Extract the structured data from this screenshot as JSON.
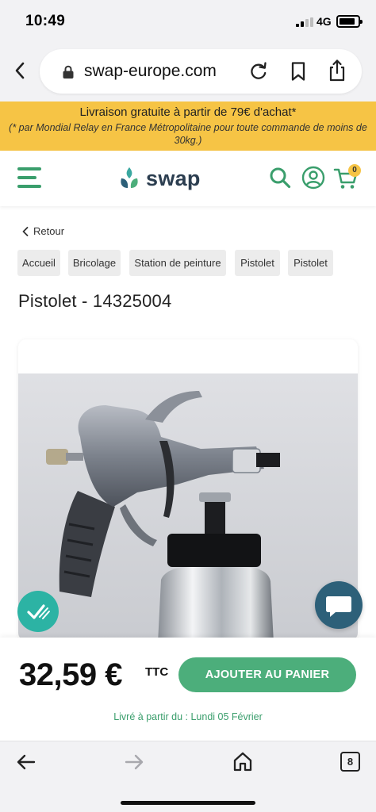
{
  "status_bar": {
    "time": "10:49",
    "network": "4G"
  },
  "browser": {
    "url": "swap-europe.com",
    "tab_count": "8"
  },
  "promo": {
    "main": "Livraison gratuite à partir de 79€ d'achat*",
    "sub": "(* par Mondial Relay en France Métropolitaine pour toute commande de moins de 30kg.)"
  },
  "header": {
    "logo_text": "swap",
    "cart_count": "0",
    "brand_color": "#3a9e6c",
    "accent_color": "#f6c445"
  },
  "breadcrumb": {
    "back_label": "Retour",
    "items": [
      {
        "label": "Accueil"
      },
      {
        "label": "Bricolage"
      },
      {
        "label": "Station de peinture"
      },
      {
        "label": "Pistolet"
      },
      {
        "label": "Pistolet"
      }
    ]
  },
  "product": {
    "title": "Pistolet - 14325004",
    "price": "32,59 €",
    "tax_label": "TTC",
    "add_to_cart": "AJOUTER AU PANIER",
    "delivery": "Livré à partir du : Lundi 05 Février"
  },
  "icons": {
    "verified": "verified-check-icon",
    "chat": "chat-bubble-icon"
  }
}
